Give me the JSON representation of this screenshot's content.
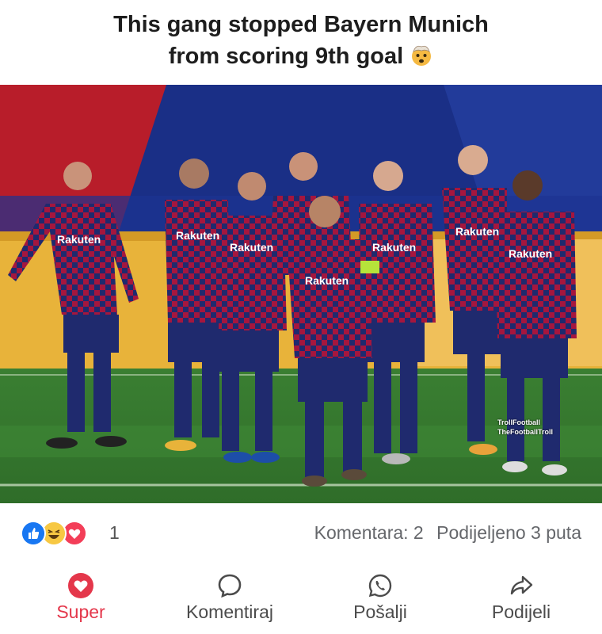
{
  "post": {
    "caption_line1": "This gang stopped Bayern Munich",
    "caption_line2": "from scoring 9th goal",
    "caption_emoji": "exploding-head-icon"
  },
  "photo": {
    "jersey_sponsor": "Rakuten",
    "watermark_line1": "TrollFootball",
    "watermark_line2": "TheFootballTroll"
  },
  "stats": {
    "reaction_icons": [
      "like-icon",
      "haha-icon",
      "love-icon"
    ],
    "reaction_count": "1",
    "comments": "Komentara: 2",
    "shares": "Podijeljeno 3 puta"
  },
  "actions": [
    {
      "label": "Super",
      "icon": "heart-icon",
      "active": true
    },
    {
      "label": "Komentiraj",
      "icon": "comment-icon",
      "active": false
    },
    {
      "label": "Pošalji",
      "icon": "whatsapp-icon",
      "active": false
    },
    {
      "label": "Podijeli",
      "icon": "share-icon",
      "active": false
    }
  ],
  "colors": {
    "active": "#e4374b",
    "like_blue": "#1877f2",
    "haha_yellow": "#f7c843",
    "love_red": "#f33e58",
    "jersey_blue": "#1f2a6e",
    "jersey_red": "#a5163e",
    "pitch_green": "#3f8b37"
  }
}
